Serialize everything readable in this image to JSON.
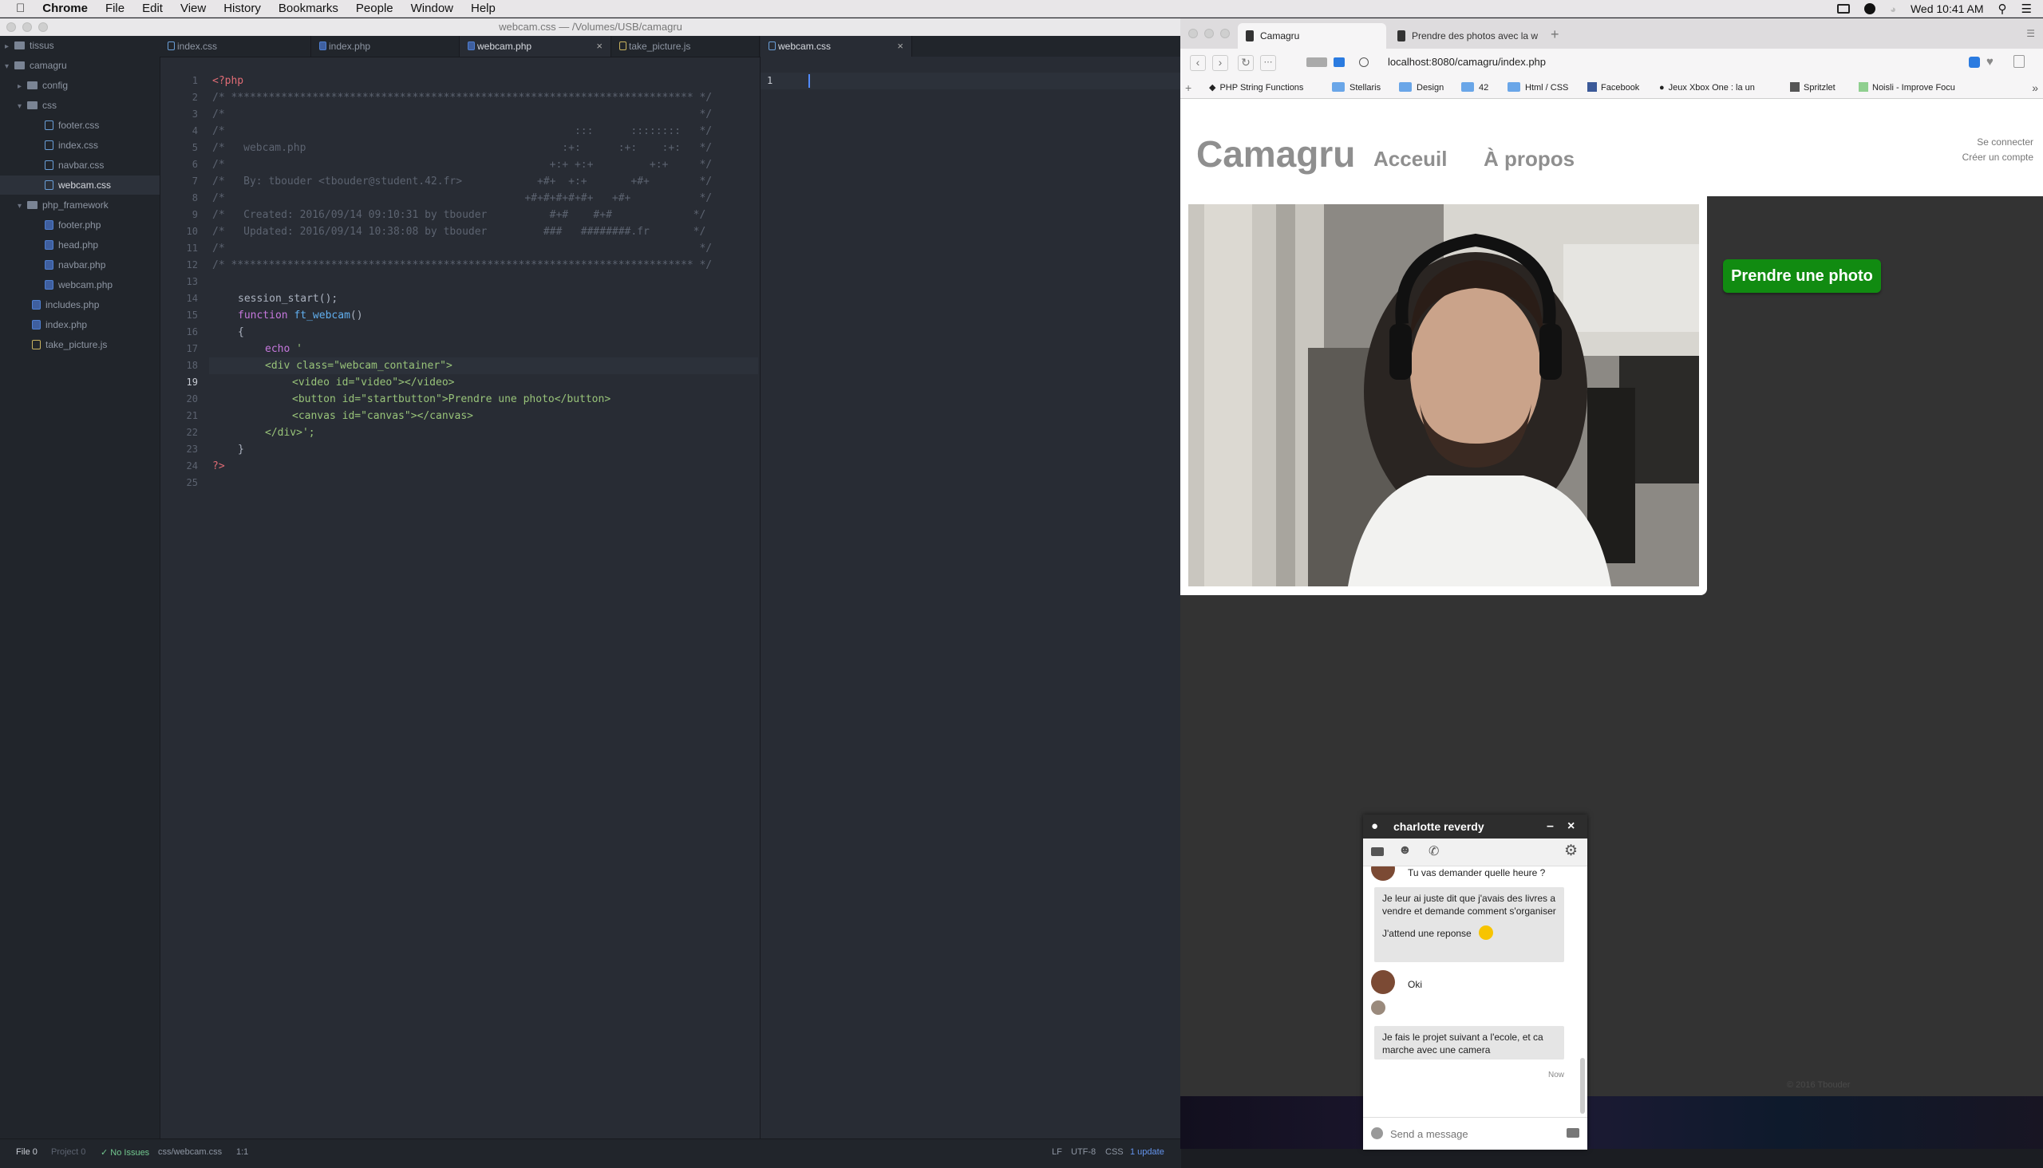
{
  "menubar": {
    "app": "Chrome",
    "items": [
      "File",
      "Edit",
      "View",
      "History",
      "Bookmarks",
      "People",
      "Window",
      "Help"
    ],
    "clock": "Wed 10:41 AM"
  },
  "atom": {
    "title": "webcam.css — /Volumes/USB/camagru",
    "tree": [
      {
        "label": "tissus",
        "type": "repo"
      },
      {
        "label": "camagru",
        "type": "folder-open"
      },
      {
        "label": "config",
        "type": "folder"
      },
      {
        "label": "css",
        "type": "folder-open"
      },
      {
        "label": "footer.css",
        "type": "css"
      },
      {
        "label": "index.css",
        "type": "css"
      },
      {
        "label": "navbar.css",
        "type": "css"
      },
      {
        "label": "webcam.css",
        "type": "css"
      },
      {
        "label": "php_framework",
        "type": "folder-open"
      },
      {
        "label": "footer.php",
        "type": "php"
      },
      {
        "label": "head.php",
        "type": "php"
      },
      {
        "label": "navbar.php",
        "type": "php"
      },
      {
        "label": "webcam.php",
        "type": "php"
      },
      {
        "label": "includes.php",
        "type": "php"
      },
      {
        "label": "index.php",
        "type": "php"
      },
      {
        "label": "take_picture.js",
        "type": "js"
      }
    ],
    "tabs": [
      "index.css",
      "index.php",
      "webcam.php",
      "take_picture.js"
    ],
    "tab2": "webcam.css",
    "code": {
      "l1": "<?php",
      "l2": "/* ************************************************************************** */",
      "l3": "/*                                                                            */",
      "l4": "/*                                                        :::      ::::::::   */",
      "l5": "/*   webcam.php                                         :+:      :+:    :+:   */",
      "l6": "/*                                                    +:+ +:+         +:+     */",
      "l7": "/*   By: tbouder <tbouder@student.42.fr>            +#+  +:+       +#+        */",
      "l8": "/*                                                +#+#+#+#+#+   +#+           */",
      "l9": "/*   Created: 2016/09/14 09:10:31 by tbouder          #+#    #+#             */",
      "l10": "/*   Updated: 2016/09/14 10:38:08 by tbouder         ###   ########.fr       */",
      "l11": "/*                                                                            */",
      "l12": "/* ************************************************************************** */",
      "l14": "session_start();",
      "l15a": "function",
      "l15b": " ft_webcam",
      "l15c": "()",
      "l16": "{",
      "l17a": "echo",
      "l17b": " '",
      "l18": "<div class=\"webcam_container\">",
      "l19": "<video id=\"video\"></video>",
      "l20": "<button id=\"startbutton\">Prendre une photo</button>",
      "l21": "<canvas id=\"canvas\"></canvas>",
      "l22": "</div>';",
      "l23": "}",
      "l24": "?>"
    },
    "status": {
      "file": "File 0",
      "project": "Project 0",
      "issues": "✓ No Issues",
      "path": "css/webcam.css",
      "pos": "1:1",
      "lf": "LF",
      "enc": "UTF-8",
      "grammar": "CSS",
      "update": "1 update"
    }
  },
  "chrome": {
    "tab1": "Camagru",
    "tab2": "Prendre des photos avec la w",
    "url": "localhost:8080/camagru/index.php",
    "bookmarks": [
      "PHP String Functions",
      "Stellaris",
      "Design",
      "42",
      "Html / CSS",
      "Facebook",
      "Jeux Xbox One : la un",
      "Spritzlet",
      "Noisli - Improve Focu"
    ],
    "site": {
      "logo": "Camagru",
      "nav": [
        "Acceuil",
        "À propos"
      ],
      "login": "Se connecter",
      "signup": "Créer un compte",
      "button": "Prendre une photo",
      "footer": "© 2016 Tbouder"
    }
  },
  "hangout": {
    "name": "charlotte reverdy",
    "messages": [
      "Tu vas demander quelle heure ?",
      "Je leur ai juste dit que j'avais des livres a vendre et demande comment s'organiser",
      "J'attend une reponse",
      "Oki",
      "Je fais le projet suivant a l'ecole, et ca marche avec une camera"
    ],
    "time": "Now",
    "placeholder": "Send a message"
  }
}
